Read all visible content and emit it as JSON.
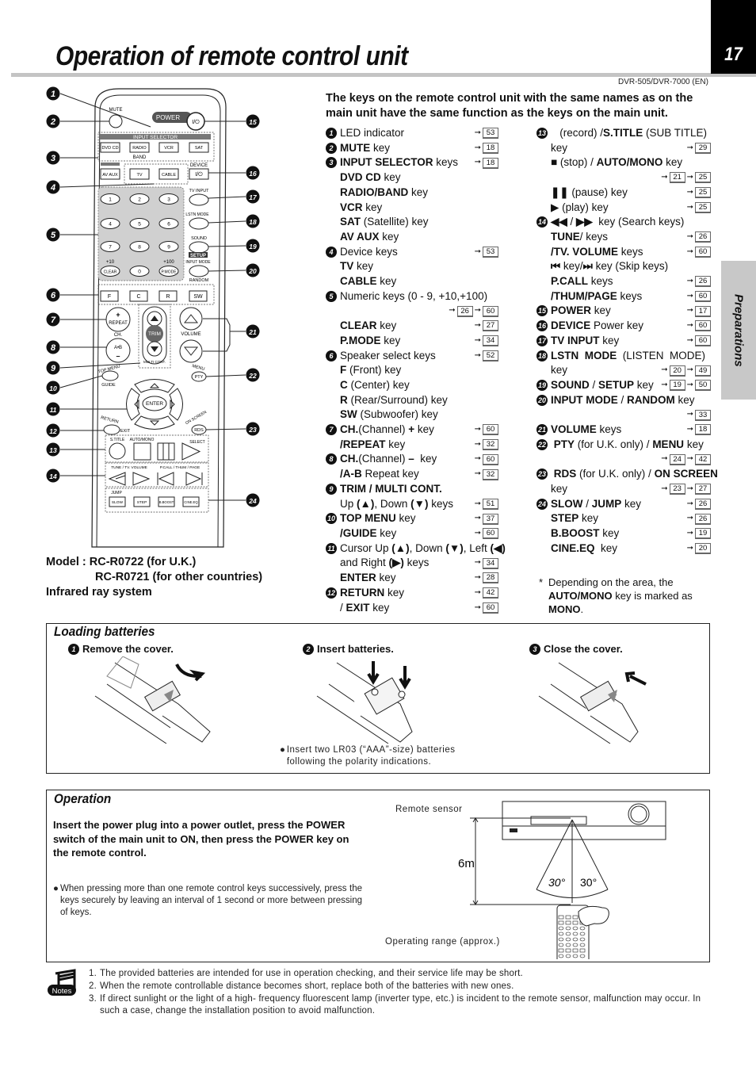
{
  "header": {
    "title": "Operation of remote control unit",
    "page_number": "17",
    "model_code": "DVR-505/DVR-7000 (EN)",
    "side_tab": "Preparations"
  },
  "intro": "The keys on the remote control unit with the same names as on the main unit have the same function as the keys on the main unit.",
  "remote_labels": {
    "mute": "MUTE",
    "power": "POWER",
    "power_sym": "I/⏻",
    "input_selector": "INPUT SELECTOR",
    "dvd_cd": "DVD CD",
    "radio": "RADIO",
    "vcr": "VCR",
    "sat": "SAT",
    "band": "BAND",
    "av_aux": "AV AUX",
    "tv": "TV",
    "cable": "CABLE",
    "device": "DEVICE",
    "tv_input": "TV INPUT",
    "lstn_mode": "LSTN MODE",
    "sound": "SOUND",
    "setup": "SETUP",
    "input_mode": "INPUT MODE",
    "random": "RANDOM",
    "plus10": "+10",
    "plus100": "+100",
    "clear": "CLEAR",
    "pmode": "P.MODE",
    "digits": [
      "1",
      "2",
      "3",
      "4",
      "5",
      "6",
      "7",
      "8",
      "9",
      "0"
    ],
    "f": "F",
    "c": "C",
    "r": "R",
    "sw": "SW",
    "repeat": "REPEAT",
    "ch": "CH.",
    "ab": "A•B",
    "trim": "TRIM",
    "multi_cont": "MULTI CONT.",
    "volume": "VOLUME",
    "top_menu": "TOP MENU",
    "guide": "GUIDE",
    "menu": "MENU",
    "pty": "PTY",
    "enter": "ENTER",
    "return": "RETURN",
    "exit": "EXIT",
    "on_screen": "ON SCREEN",
    "rds": "RDS",
    "s_title": "S.TITLE",
    "auto_mono": "AUTO/MONO",
    "select": "SELECT",
    "tune_tv_volume": "TUNE / TV. VOLUME",
    "pcall_thum_page": "P.CALL / THUM / PAGE",
    "jump": "JUMP",
    "slow": "SLOW",
    "step": "STEP",
    "bboost": "B.BOOST",
    "cine_eq": "CINE.EQ",
    "callouts": [
      "1",
      "2",
      "3",
      "4",
      "5",
      "6",
      "7",
      "8",
      "9",
      "10",
      "11",
      "12",
      "13",
      "14",
      "15",
      "16",
      "17",
      "18",
      "19",
      "20",
      "21",
      "22",
      "23",
      "24"
    ]
  },
  "model_info": {
    "line1": "Model : RC-R0722 (for U.K.)",
    "line2": "RC-R0721 (for other countries)",
    "line3": "Infrared ray system"
  },
  "key_list_col1": [
    {
      "num": "1",
      "html": "LED indicator",
      "refs": [
        "53"
      ]
    },
    {
      "num": "2",
      "html": "<b>MUTE</b> key",
      "refs": [
        "18"
      ]
    },
    {
      "num": "3",
      "html": "<b>INPUT SELECTOR</b> keys",
      "refs": [
        "18"
      ]
    },
    {
      "html": "<b>DVD CD</b> key",
      "refs": []
    },
    {
      "html": "<b>RADIO/BAND</b> key",
      "refs": []
    },
    {
      "html": "<b>VCR</b> key",
      "refs": []
    },
    {
      "html": "<b>SAT</b> (Satellite) key",
      "refs": []
    },
    {
      "html": "<b>AV AUX</b> key",
      "refs": []
    },
    {
      "num": "4",
      "html": "Device keys",
      "refs": [
        "53"
      ]
    },
    {
      "html": "<b>TV</b> key",
      "refs": []
    },
    {
      "html": "<b>CABLE</b> key",
      "refs": []
    },
    {
      "num": "5",
      "html": "Numeric keys (0 - 9, +10,+100)",
      "refs": []
    },
    {
      "html": "",
      "refs": [
        "26",
        "60"
      ]
    },
    {
      "html": "<b>CLEAR</b> key",
      "refs": [
        "27"
      ]
    },
    {
      "html": "<b>P.MODE</b> key",
      "refs": [
        "34"
      ]
    },
    {
      "num": "6",
      "html": "Speaker select keys",
      "refs": [
        "52"
      ]
    },
    {
      "html": "<b>F</b> (Front) key",
      "refs": []
    },
    {
      "html": "<b>C</b> (Center) key",
      "refs": []
    },
    {
      "html": "<b>R</b> (Rear/Surround) key",
      "refs": []
    },
    {
      "html": "<b>SW</b> (Subwoofer) key",
      "refs": []
    },
    {
      "num": "7",
      "html": "<b>CH.</b>(Channel) <b>+</b> key",
      "refs": [
        "60"
      ]
    },
    {
      "html": "<b>/REPEAT</b> key",
      "refs": [
        "32"
      ]
    },
    {
      "num": "8",
      "html": "<b>CH.</b>(Channel) <b>–</b>&nbsp; key",
      "refs": [
        "60"
      ]
    },
    {
      "html": "<b>/A-B</b> Repeat key",
      "refs": [
        "32"
      ]
    },
    {
      "num": "9",
      "html": "<b>TRIM / MULTI CONT.</b>",
      "refs": []
    },
    {
      "html": "Up <b>(▲)</b>, Down <b>(▼)</b> keys",
      "refs": [
        "51"
      ]
    },
    {
      "num": "10",
      "html": "<b>TOP MENU</b> key",
      "refs": [
        "37"
      ]
    },
    {
      "html": "<b>/GUIDE</b> key",
      "refs": [
        "60"
      ]
    },
    {
      "num": "11",
      "html": "Cursor Up <b>(▲)</b>, Down <b>(▼)</b>, Left <b>(◀)</b>",
      "refs": []
    },
    {
      "html": "and Right <b>(▶)</b> keys",
      "refs": [
        "34"
      ]
    },
    {
      "html": "<b>ENTER</b> key",
      "refs": [
        "28"
      ]
    },
    {
      "num": "12",
      "html": "<b>RETURN</b> key",
      "refs": [
        "42"
      ]
    },
    {
      "html": "/ <b>EXIT</b> key",
      "refs": [
        "60"
      ]
    }
  ],
  "key_list_col2": [
    {
      "num": "13",
      "html": "&nbsp;&nbsp;&nbsp;(record) /<b>S.TITLE</b> (SUB TITLE)",
      "refs": []
    },
    {
      "html": "key",
      "refs": [
        "29"
      ]
    },
    {
      "html": "■ (stop) / <b>AUTO/MONO</b> key",
      "refs": []
    },
    {
      "html": "",
      "refs": [
        "21",
        "25"
      ]
    },
    {
      "html": "<b>❚❚</b> (pause) key",
      "refs": [
        "25"
      ]
    },
    {
      "html": "▶ (play) key",
      "refs": [
        "25"
      ]
    },
    {
      "num": "14",
      "html": "<b>◀◀</b> / <b>▶▶</b>&nbsp; key (Search keys)",
      "refs": []
    },
    {
      "html": "<b>TUNE</b>/ keys",
      "refs": [
        "26"
      ]
    },
    {
      "html": "<b>/TV. VOLUME</b> keys",
      "refs": [
        "60"
      ]
    },
    {
      "html": "<b>⏮</b> key/<b>⏭</b> key (Skip keys)",
      "refs": []
    },
    {
      "html": "<b>P.CALL</b> keys",
      "refs": [
        "26"
      ]
    },
    {
      "html": "<b>/THUM/PAGE</b> keys",
      "refs": [
        "60"
      ]
    },
    {
      "num": "15",
      "html": "<b>POWER</b> key",
      "refs": [
        "17"
      ]
    },
    {
      "num": "16",
      "html": "<b>DEVICE</b> Power key",
      "refs": [
        "60"
      ]
    },
    {
      "num": "17",
      "html": "<b>TV INPUT</b> key",
      "refs": [
        "60"
      ]
    },
    {
      "num": "18",
      "html": "<b>LSTN&nbsp; MODE</b>&nbsp; (LISTEN&nbsp; MODE)",
      "refs": []
    },
    {
      "html": "key",
      "refs": [
        "20",
        "49"
      ]
    },
    {
      "num": "19",
      "html": "<b>SOUND</b> / <b>SETUP</b> key",
      "refs": [
        "19",
        "50"
      ]
    },
    {
      "num": "20",
      "html": "<b>INPUT MODE</b> / <b>RANDOM</b> key",
      "refs": []
    },
    {
      "html": "",
      "refs": [
        "33"
      ]
    },
    {
      "num": "21",
      "html": "<b>VOLUME</b> keys",
      "refs": [
        "18"
      ]
    },
    {
      "num": "22",
      "html": "&nbsp;<b>PTY</b> (for U.K. only) / <b>MENU</b> key",
      "refs": []
    },
    {
      "html": "",
      "refs": [
        "24",
        "42"
      ]
    },
    {
      "num": "23",
      "html": "&nbsp;<b>RDS</b> (for U.K. only) / <b>ON SCREEN</b>",
      "refs": []
    },
    {
      "html": "key",
      "refs": [
        "23",
        "27"
      ]
    },
    {
      "num": "24",
      "html": "<b>SLOW</b> / <b>JUMP</b> key",
      "refs": [
        "26"
      ]
    },
    {
      "html": "<b>STEP</b> key",
      "refs": [
        "26"
      ]
    },
    {
      "html": "<b>B.BOOST</b> key",
      "refs": [
        "19"
      ]
    },
    {
      "html": "<b>CINE.EQ</b>&nbsp; key",
      "refs": [
        "20"
      ]
    }
  ],
  "footnote": {
    "mark": "*",
    "text_a": "Depending on the area, the",
    "text_b_bold": "AUTO/MONO",
    "text_b": " key is marked as",
    "text_c_bold": "MONO",
    "text_c": "."
  },
  "loading_batteries": {
    "title": "Loading batteries",
    "steps": [
      {
        "num": "1",
        "label": "Remove the cover."
      },
      {
        "num": "2",
        "label": "Insert batteries."
      },
      {
        "num": "3",
        "label": "Close the cover."
      }
    ],
    "bullet": "Insert two LR03 (“AAA”-size) batteries following the polarity indications."
  },
  "operation": {
    "title": "Operation",
    "instruction": "Insert the power plug into a power outlet, press the POWER switch of the main unit to ON, then press the POWER key on the remote control.",
    "bullet": "When pressing more than one remote control keys successively, press the keys securely by leaving an interval of 1 second or more between pressing of keys.",
    "diagram": {
      "remote_sensor_label": "Remote sensor",
      "distance": "6m",
      "angle_left": "30°",
      "angle_right": "30°",
      "range_label": "Operating range (approx.)"
    }
  },
  "notes": {
    "icon_label": "Notes",
    "items": [
      {
        "n": "1.",
        "text": "The provided batteries are intended for use in operation checking, and their service life may be short."
      },
      {
        "n": "2.",
        "text": "When the remote controllable distance becomes short, replace both of the batteries with new ones."
      },
      {
        "n": "3.",
        "text": "If direct sunlight or the light of a high- frequency fluorescent lamp (inverter type, etc.) is incident to the remote sensor, malfunction may occur. In such a case, change the installation position to avoid malfunction."
      }
    ]
  }
}
